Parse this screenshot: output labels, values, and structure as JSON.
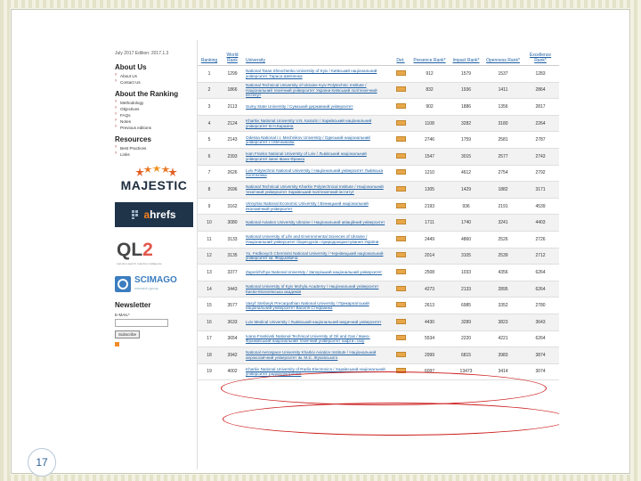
{
  "slide": {
    "page_number": "17"
  },
  "sidebar": {
    "edition": "July 2017 Edition: 2017.1.3",
    "about_us_title": "About Us",
    "about_us_links": [
      "About Us",
      "Contact Us"
    ],
    "about_ranking_title": "About the Ranking",
    "about_ranking_links": [
      "Methodology",
      "Objectives",
      "FAQs",
      "Notes",
      "Previous editions"
    ],
    "resources_title": "Resources",
    "resources_links": [
      "Best Practices",
      "Links"
    ],
    "logos": {
      "majestic": "MAJESTIC",
      "ahrefs_prefix": "a",
      "ahrefs_rest": "hrefs",
      "ql2_q": "QL",
      "ql2_2": "2",
      "ql2_tag": "real-time search. real-time intelligence",
      "scimago": "SCIMAGO",
      "scimago_sub": "research group"
    },
    "newsletter_title": "Newsletter",
    "email_label": "E-MAIL*",
    "subscribe_label": "Subscribe"
  },
  "table": {
    "headers": {
      "ranking": "Ranking",
      "world_rank": "World Rank",
      "university": "University",
      "det": "Det.",
      "presence": "Presence Rank*",
      "impact": "Impact Rank*",
      "openness": "Openness Rank*",
      "excellence": "Excellence Rank*"
    },
    "rows": [
      {
        "rank": "1",
        "world": "1299",
        "name": "National Taras Shevchenko University of Kyiv / Київський національний університет Тараса Шевченка",
        "presence": "912",
        "impact": "1579",
        "openness": "1537",
        "excellence": "1283"
      },
      {
        "rank": "2",
        "world": "1866",
        "name": "National Technical University of Ukraine Kyiv Polytechnic Institute / Національний технічний університет України Київський політехнічний інститут",
        "presence": "832",
        "impact": "1936",
        "openness": "1411",
        "excellence": "2864"
      },
      {
        "rank": "3",
        "world": "2113",
        "name": "Sumy State University / Сумський державний університет",
        "presence": "902",
        "impact": "1886",
        "openness": "1356",
        "excellence": "2817"
      },
      {
        "rank": "4",
        "world": "2124",
        "name": "Kharkiv National University V.N. Karazin / Харківський національний університет В.Н.Каразіна",
        "presence": "1108",
        "impact": "3282",
        "openness": "3180",
        "excellence": "2264"
      },
      {
        "rank": "5",
        "world": "2143",
        "name": "Odessa National I.I. Mechnikov University / Одеський національний університет І.І.Мечникова",
        "presence": "2746",
        "openness": "2581",
        "impact": "1759",
        "excellence": "2787"
      },
      {
        "rank": "6",
        "world": "2393",
        "name": "Ivan Franko National University of Lviv / Львівський національний університет імені Івана Франка",
        "presence": "1547",
        "impact": "3015",
        "openness": "2577",
        "excellence": "2743"
      },
      {
        "rank": "7",
        "world": "2626",
        "name": "Lviv Polytechnic National University / Національний університет Львівська політехніка",
        "presence": "1210",
        "impact": "4612",
        "openness": "2754",
        "excellence": "2792"
      },
      {
        "rank": "8",
        "world": "2696",
        "name": "National Technical University Kharkiv Polytechnical Institute / Національний технічний університет Харківський політехнічний інститут",
        "presence": "1305",
        "impact": "1429",
        "openness": "1882",
        "excellence": "3171"
      },
      {
        "rank": "9",
        "world": "3162",
        "name": "Vinnytsia National Economic University / Вінницький національний економічний університет",
        "presence": "2193",
        "impact": "936",
        "openness": "2191",
        "excellence": "4539"
      },
      {
        "rank": "10",
        "world": "3080",
        "name": "National Aviation University Ukraine / Національний авіаційний університет",
        "presence": "1711",
        "impact": "1740",
        "openness": "3241",
        "excellence": "4403"
      },
      {
        "rank": "11",
        "world": "3133",
        "name": "National University of Life and Environmental Sciences of Ukraine / Національний університет біоресурсів і природокористування України",
        "presence": "2449",
        "impact": "4860",
        "openness": "2526",
        "excellence": "2726"
      },
      {
        "rank": "12",
        "world": "3135",
        "name": "Yu. Fedkovych Chernivtsi National University / Чернівецький національний університет ім. Федьковича",
        "presence": "2014",
        "impact": "3105",
        "openness": "2539",
        "excellence": "2712"
      },
      {
        "rank": "13",
        "world": "3377",
        "name": "Zaporizhzhya National University / Запорізький національний університет",
        "presence": "2508",
        "impact": "1033",
        "openness": "4356",
        "excellence": "6264"
      },
      {
        "rank": "14",
        "world": "3443",
        "name": "National University of Kyiv Mohyla Academy / Національний університет Києво-Могилянська академія",
        "presence": "4273",
        "impact": "2133",
        "openness": "2895",
        "excellence": "6264"
      },
      {
        "rank": "15",
        "world": "3577",
        "name": "Vasyl' Stefanyk Precarpathian National University / Прикарпатський національний університет Василя Стефаника",
        "presence": "2613",
        "impact": "6985",
        "openness": "3352",
        "excellence": "2780"
      },
      {
        "rank": "16",
        "world": "3633",
        "name": "Lviv Medical University / Львівський національний медичний університет",
        "presence": "4430",
        "impact": "3289",
        "openness": "3823",
        "excellence": "3643"
      },
      {
        "rank": "17",
        "world": "3654",
        "name": "Ivano-Frankivsk National Technical University of Oil and Gas / Івано-Франківський національний технічний університет нафти і газу",
        "presence": "5534",
        "impact": "2220",
        "openness": "4221",
        "excellence": "6264"
      },
      {
        "rank": "18",
        "world": "3942",
        "name": "National Aerospace University Kharkiv Aviation Institute / Національний аерокосмічний університет ім. М.Є. Жуковського",
        "presence": "2999",
        "impact": "6815",
        "openness": "3983",
        "excellence": "3874"
      },
      {
        "rank": "19",
        "world": "4002",
        "name": "Kharkiv National University of Radio Electronics / Харківський національний університет радіоелектроніки",
        "presence": "6097",
        "impact": "13473",
        "openness": "3414",
        "excellence": "3074"
      }
    ]
  }
}
